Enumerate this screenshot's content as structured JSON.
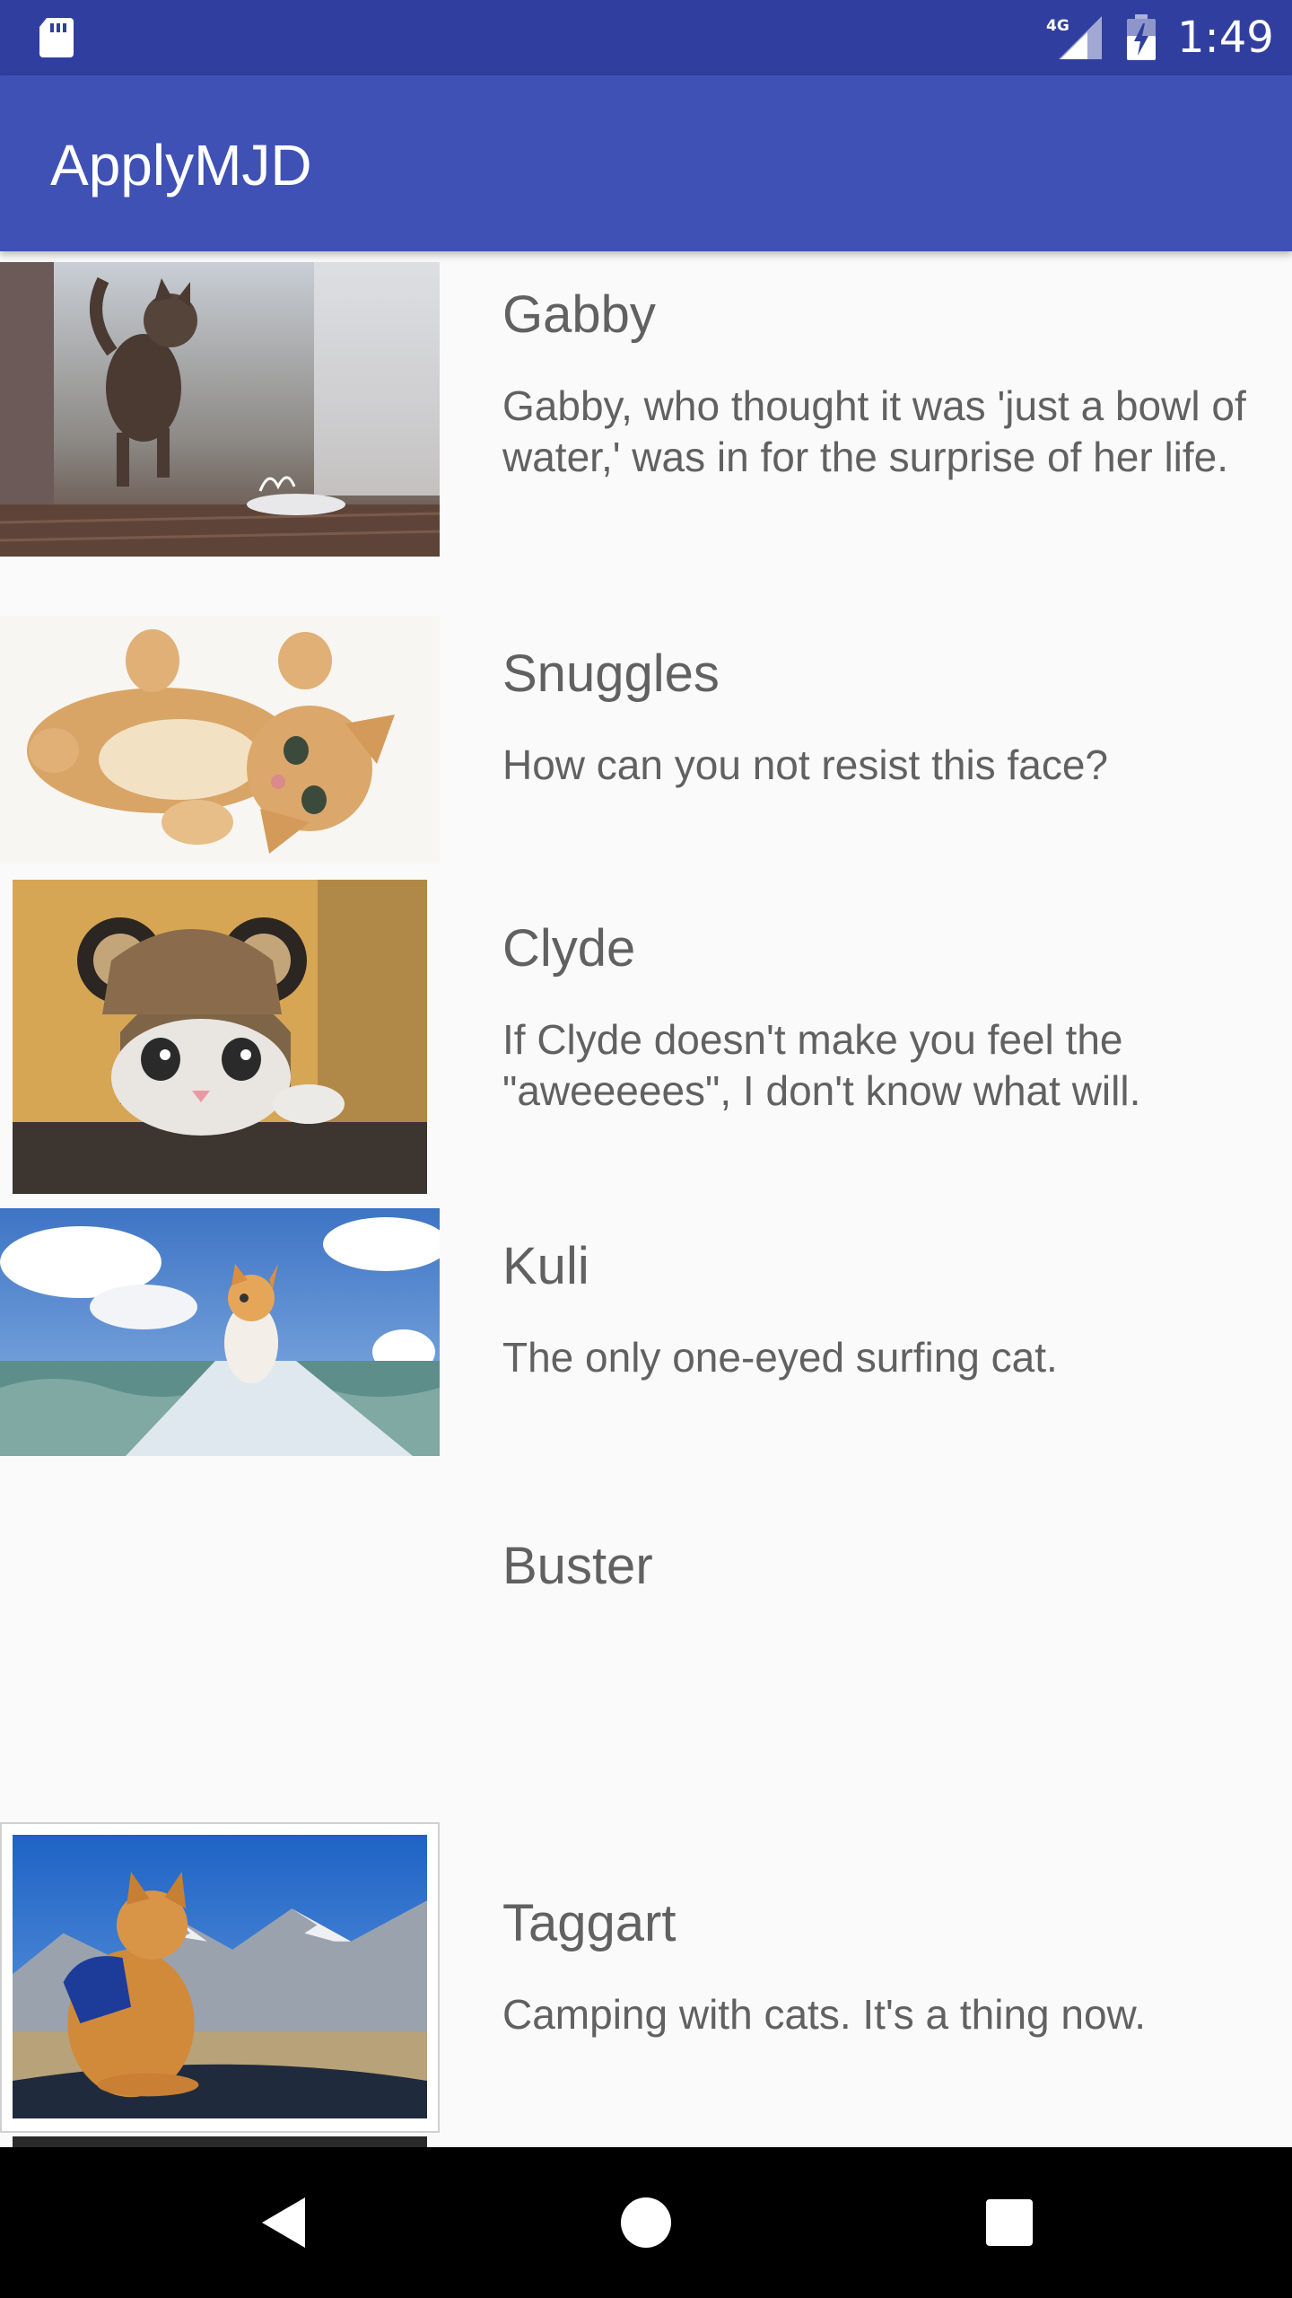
{
  "status_bar": {
    "time": "1:49",
    "network_label": "4G",
    "icons": [
      "sd-card-icon",
      "signal-4g-icon",
      "battery-charging-icon"
    ]
  },
  "app_bar": {
    "title": "ApplyMJD",
    "color": "#3f51b5",
    "status_color": "#303f9f"
  },
  "cats": [
    {
      "name": "Gabby",
      "description": "Gabby, who thought it was 'just a bowl of water,' was in for the surprise of her life.",
      "image": "kitten-jumping-water-photo"
    },
    {
      "name": "Snuggles",
      "description": "How can you not resist this face?",
      "image": "orange-kitten-lying-photo"
    },
    {
      "name": "Clyde",
      "description": "If Clyde doesn't make you feel the \"aweeeees\", I don't know what will.",
      "image": "kitten-bear-hat-photo"
    },
    {
      "name": "Kuli",
      "description": "The only one-eyed surfing cat.",
      "image": "cat-surfing-photo"
    },
    {
      "name": "Buster",
      "description": "",
      "image": ""
    },
    {
      "name": "Taggart",
      "description": "Camping with cats. It's a thing now.",
      "image": "cat-mountains-photo"
    }
  ],
  "nav": {
    "icons": [
      "back-icon",
      "home-icon",
      "recents-icon"
    ]
  }
}
